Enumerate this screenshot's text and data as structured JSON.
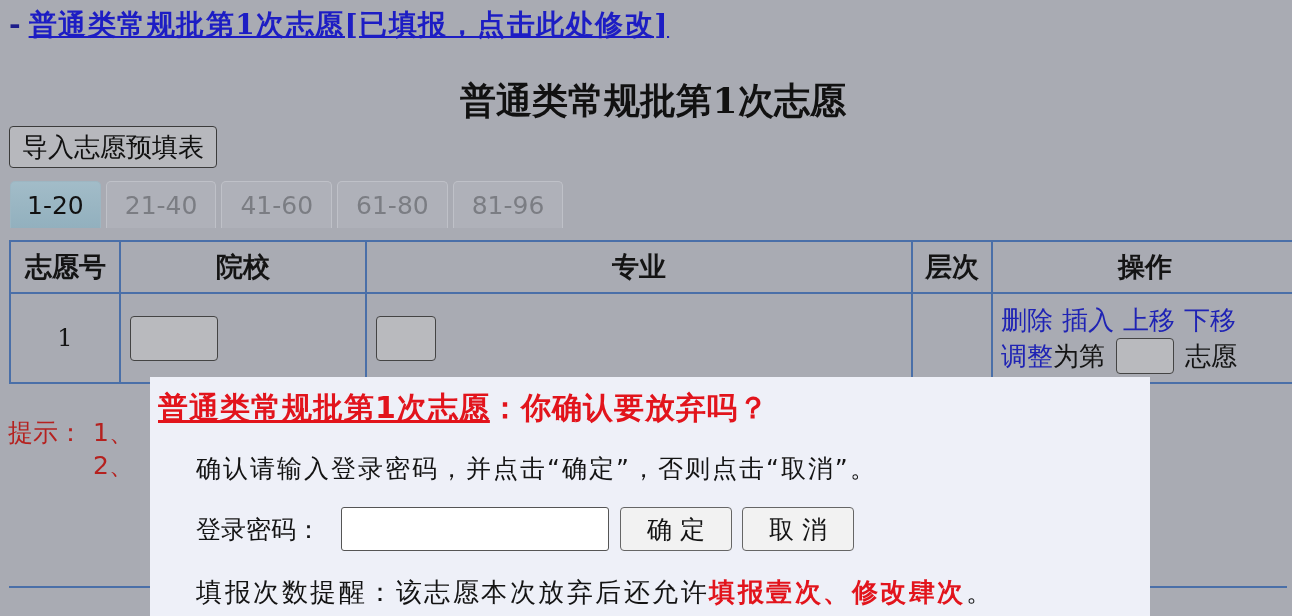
{
  "header_link": {
    "prefix": "-",
    "text": "普通类常规批第1次志愿[已填报，点击此处修改]"
  },
  "title": "普通类常规批第1次志愿",
  "import_button": "导入志愿预填表",
  "tabs": [
    {
      "label": "1-20",
      "selected": true
    },
    {
      "label": "21-40",
      "selected": false
    },
    {
      "label": "41-60",
      "selected": false
    },
    {
      "label": "61-80",
      "selected": false
    },
    {
      "label": "81-96",
      "selected": false
    }
  ],
  "table": {
    "columns": [
      "志愿号",
      "院校",
      "专业",
      "层次",
      "操作"
    ],
    "rows": [
      {
        "number": "1",
        "actions": [
          "删除",
          "插入",
          "上移",
          "下移"
        ],
        "adjust_link": "调整",
        "adjust_before": "为第",
        "adjust_after": "志愿"
      }
    ]
  },
  "hints": {
    "label": "提示：",
    "items": [
      "1、",
      "2、"
    ]
  },
  "dialog": {
    "title_link": "普通类常规批第1次志愿",
    "title_rest": "：你确认要放弃吗？",
    "instruction": "确认请输入登录密码，并点击“确定”，否则点击“取消”。",
    "password_label": "登录密码：",
    "buttons": [
      "确 定",
      "取 消"
    ],
    "reminder": "填报次数提醒：该志愿本次放弃后还允许**填报壹次、修改肆次**。"
  }
}
